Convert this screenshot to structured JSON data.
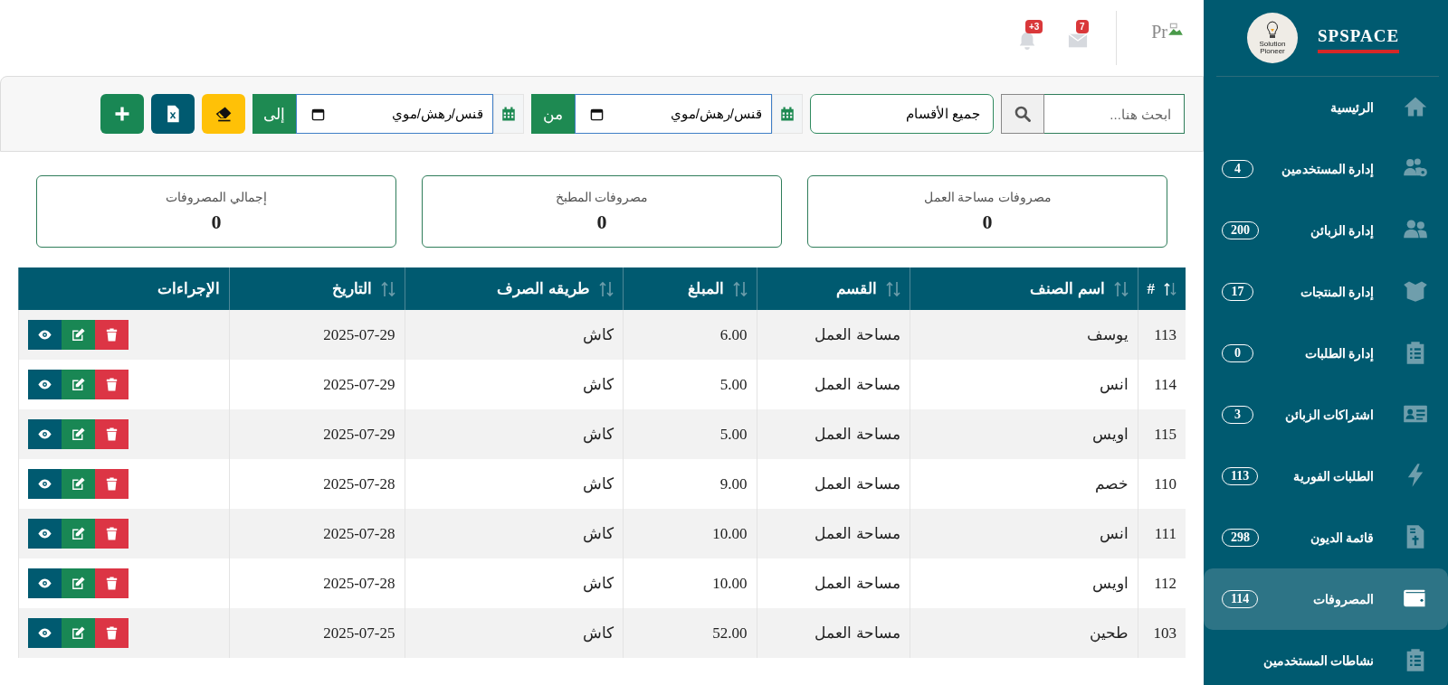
{
  "header": {
    "notifications": [
      {
        "kind": "mail",
        "badge": "7"
      },
      {
        "kind": "bell",
        "badge": "3+"
      }
    ],
    "profile_image_alt": "Pr"
  },
  "filters": {
    "search": {
      "placeholder": "ابحث هنا..."
    },
    "category": {
      "value": "جميع الأقسام"
    },
    "date_from": {
      "label": "من",
      "value": "قنس/رهش/موي"
    },
    "date_to": {
      "label": "إلى",
      "value": "قنس/رهش/موي"
    },
    "buttons": [
      {
        "kind": "clear"
      },
      {
        "kind": "excel"
      },
      {
        "kind": "add"
      }
    ]
  },
  "summary_cards": [
    {
      "title": "مصروفات مساحة العمل",
      "value": "0"
    },
    {
      "title": "مصروفات المطبخ",
      "value": "0"
    },
    {
      "title": "إجمالي المصروفات",
      "value": "0"
    }
  ],
  "table": {
    "columns": [
      {
        "label": "#",
        "kind": "sortable",
        "sorted": true
      },
      {
        "label": "اسم الصنف",
        "kind": "sortable",
        "sorted": false
      },
      {
        "label": "القسم",
        "kind": "sortable",
        "sorted": false
      },
      {
        "label": "المبلغ",
        "kind": "sortable",
        "sorted": false
      },
      {
        "label": "طريقه الصرف",
        "kind": "sortable",
        "sorted": false
      },
      {
        "label": "التاريخ",
        "kind": "sortable",
        "sorted": false
      },
      {
        "label": "الإجراءات",
        "kind": "plain"
      }
    ],
    "row_actions": [
      {
        "kind": "delete"
      },
      {
        "kind": "edit"
      },
      {
        "kind": "view"
      }
    ],
    "rows": [
      {
        "cells": [
          "113",
          "يوسف",
          "مساحة العمل",
          "6.00",
          "كاش",
          "2025-07-29"
        ]
      },
      {
        "cells": [
          "114",
          "انس",
          "مساحة العمل",
          "5.00",
          "كاش",
          "2025-07-29"
        ]
      },
      {
        "cells": [
          "115",
          "اويس",
          "مساحة العمل",
          "5.00",
          "كاش",
          "2025-07-29"
        ]
      },
      {
        "cells": [
          "110",
          "خصم",
          "مساحة العمل",
          "9.00",
          "كاش",
          "2025-07-28"
        ]
      },
      {
        "cells": [
          "111",
          "انس",
          "مساحة العمل",
          "10.00",
          "كاش",
          "2025-07-28"
        ]
      },
      {
        "cells": [
          "112",
          "اويس",
          "مساحة العمل",
          "10.00",
          "كاش",
          "2025-07-28"
        ]
      },
      {
        "cells": [
          "103",
          "طحين",
          "مساحة العمل",
          "52.00",
          "كاش",
          "2025-07-25"
        ]
      }
    ]
  },
  "sidebar": {
    "brand": "SPSPACE",
    "logo_lines": [
      "Solution",
      "Pioneer"
    ],
    "items": [
      {
        "label": "الرئيسية",
        "kind": "home",
        "selected": false
      },
      {
        "label": "إدارة المستخدمين",
        "kind": "users-gear",
        "badge": "4",
        "selected": false
      },
      {
        "label": "إدارة الزبائن",
        "kind": "users",
        "badge": "200",
        "selected": false
      },
      {
        "label": "إدارة المنتجات",
        "kind": "box",
        "badge": "17",
        "selected": false
      },
      {
        "label": "إدارة الطلبات",
        "kind": "clipboard",
        "badge": "0",
        "selected": false
      },
      {
        "label": "اشتراكات الزبائن",
        "kind": "id-card",
        "badge": "3",
        "selected": false
      },
      {
        "label": "الطلبات الفورية",
        "kind": "bolt",
        "badge": "113",
        "selected": false
      },
      {
        "label": "قائمة الديون",
        "kind": "invoice",
        "badge": "298",
        "selected": false
      },
      {
        "label": "المصروفات",
        "kind": "wallet",
        "badge": "114",
        "selected": true
      },
      {
        "label": "نشاطات المستخدمين",
        "kind": "clipboard",
        "selected": false
      }
    ]
  }
}
